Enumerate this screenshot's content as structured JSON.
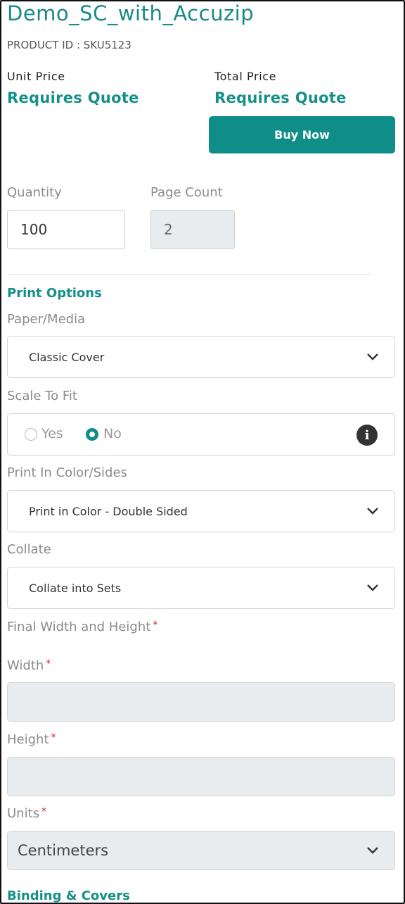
{
  "product": {
    "title": "Demo_SC_with_Accuzip",
    "product_id": "PRODUCT ID : SKU5123"
  },
  "pricing": {
    "unit_label": "Unit Price",
    "unit_value": "Requires Quote",
    "total_label": "Total Price",
    "total_value": "Requires Quote",
    "buy_label": "Buy Now"
  },
  "quantity": {
    "label": "Quantity",
    "value": "100"
  },
  "page_count": {
    "label": "Page Count",
    "value": "2"
  },
  "print_options": {
    "section_title": "Print Options",
    "paper_media": {
      "label": "Paper/Media",
      "selected": "Classic Cover"
    },
    "scale_to_fit": {
      "label": "Scale To Fit",
      "options": [
        "Yes",
        "No"
      ],
      "selected": "No",
      "info_icon": "info-icon"
    },
    "print_color_sides": {
      "label": "Print In Color/Sides",
      "selected": "Print in Color - Double Sided"
    },
    "collate": {
      "label": "Collate",
      "selected": "Collate into Sets"
    },
    "final_size": {
      "label": "Final Width and Height",
      "required_mark": "*"
    },
    "width": {
      "label": "Width",
      "required_mark": "*",
      "value": ""
    },
    "height": {
      "label": "Height",
      "required_mark": "*",
      "value": ""
    },
    "units": {
      "label": "Units",
      "required_mark": "*",
      "selected": "Centimeters"
    }
  },
  "binding": {
    "section_title": "Binding & Covers"
  },
  "colors": {
    "accent": "#159089",
    "button": "#0f8e89",
    "required": "#cc1f1f",
    "disabled_bg": "#e9ecef"
  }
}
